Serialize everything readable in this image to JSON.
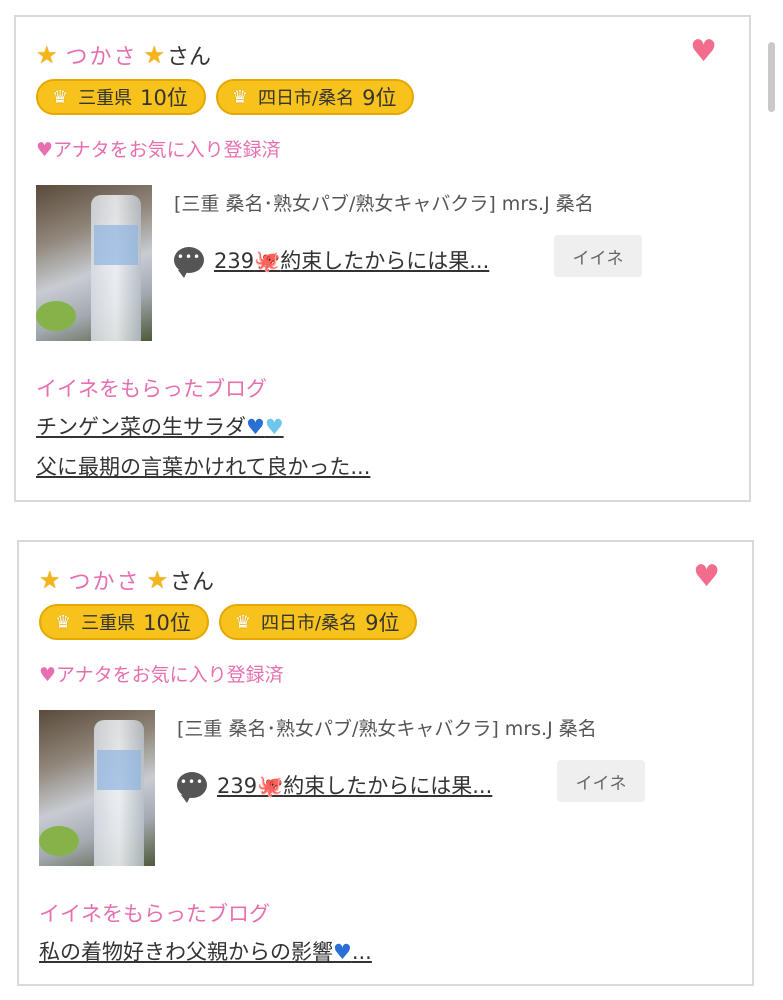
{
  "cards": [
    {
      "name": "つかさ",
      "san": "さん",
      "badges": [
        {
          "area": "三重県",
          "rank": "10位"
        },
        {
          "area": "四日市/桑名",
          "rank": "9位"
        }
      ],
      "fav_status": "♥アナタをお気に入り登録済",
      "shop": "[三重 桑名･熟女パブ/熟女キャバクラ]  mrs.J 桑名",
      "blog_count": "239",
      "blog_title": "約束したからには果...",
      "iine_label": "イイネ",
      "liked_heading": "イイネをもらったブログ",
      "liked_blogs": [
        "チンゲン菜の生サラダ",
        "父に最期の言葉かけれて良かった..."
      ]
    },
    {
      "name": "つかさ",
      "san": "さん",
      "badges": [
        {
          "area": "三重県",
          "rank": "10位"
        },
        {
          "area": "四日市/桑名",
          "rank": "9位"
        }
      ],
      "fav_status": "♥アナタをお気に入り登録済",
      "shop": "[三重 桑名･熟女パブ/熟女キャバクラ]  mrs.J 桑名",
      "blog_count": "239",
      "blog_title": "約束したからには果...",
      "iine_label": "イイネ",
      "liked_heading": "イイネをもらったブログ",
      "liked_blogs": [
        "私の着物好きわ父親からの影響",
        "..."
      ]
    }
  ],
  "icons": {
    "star": "star-icon",
    "heart": "heart-icon",
    "crown": "crown-icon",
    "comment": "comment-bubble-icon",
    "octopus": "octopus-emoji",
    "blue_heart": "blue-heart-emoji",
    "light_blue_heart": "light-blue-heart-emoji"
  },
  "colors": {
    "name_pink": "#e76fb0",
    "badge_yellow": "#f7c21b",
    "heart_red": "#f26c8d",
    "border": "#d9d9d9"
  }
}
